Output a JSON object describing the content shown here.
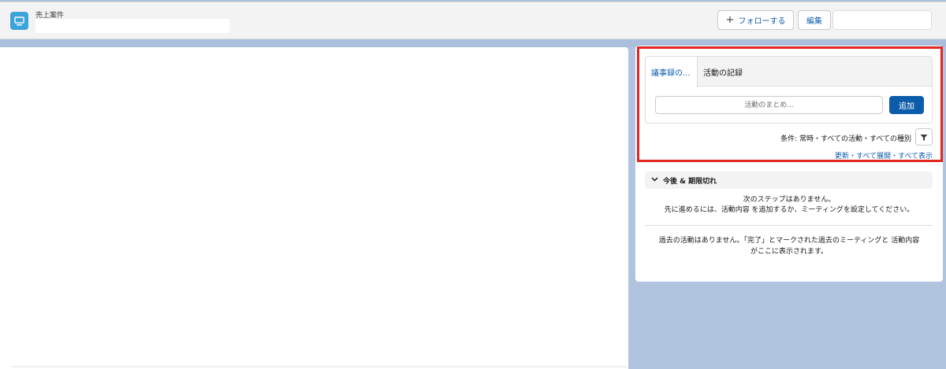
{
  "header": {
    "record_type": "売上案件",
    "record_name": "",
    "follow_label": "フォローする",
    "edit_label": "編集"
  },
  "activity": {
    "tabs": [
      {
        "label": "議事録の..."
      },
      {
        "label": "活動の記録"
      }
    ],
    "summary_placeholder": "活動のまとめ...",
    "add_label": "追加",
    "filter_text": "条件: 常時・すべての活動・すべての種別",
    "links": {
      "refresh": "更新",
      "expand_all": "すべて展開",
      "show_all": "すべて表示",
      "separator": "・"
    }
  },
  "upcoming": {
    "title": "今後 & 期限切れ",
    "no_next_steps": "次のステップはありません。",
    "hint": "先に進めるには、活動内容 を追加するか、ミーティングを設定してください。"
  },
  "past": {
    "line1": "過去の活動はありません。「完了」とマークされた過去のミーティングと 活動内容",
    "line2": "がここに表示されます。"
  },
  "colors": {
    "brand": "#0b5cab",
    "highlight": "#e3261d",
    "record_icon": "#3ba4d8",
    "background": "#b0c4df"
  },
  "icons": {
    "record": "monitor-icon",
    "follow": "plus-icon",
    "filter": "filter-icon",
    "collapse": "chevron-down-icon"
  }
}
